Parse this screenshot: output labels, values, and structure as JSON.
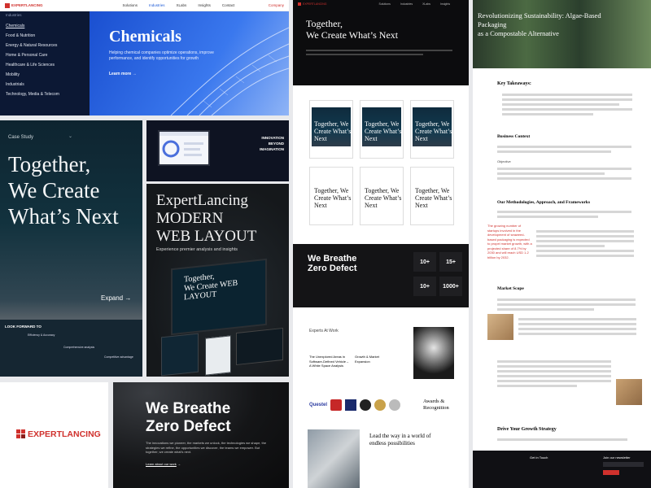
{
  "nav": {
    "brand": "EXPERTLANCING",
    "items": [
      "Solutions",
      "Industries",
      "XLabs",
      "Insights",
      "Contact"
    ],
    "company": "Company"
  },
  "industries": {
    "label": "Industries",
    "list": [
      "Chemicals",
      "Food & Nutrition",
      "Energy & Natural Resources",
      "Home & Personal Care",
      "Healthcare & Life Sciences",
      "Mobility",
      "Industrials",
      "Technology, Media & Telecom"
    ],
    "hero_title": "Chemicals",
    "hero_text": "Helping chemical companies optimize operations, improve performance, and identify opportunities for growth",
    "learn_more": "Learn more"
  },
  "case_study": {
    "label": "Case Study",
    "title_lines": [
      "Together,",
      "We Create",
      "What’s Next"
    ],
    "expand": "Expand",
    "look_forward": "LOOK FORWARD TO",
    "efficiency": "Efficiency & Accuracy",
    "comprehensive": "Comprehensive analysis",
    "competitive": "Competitive advantage"
  },
  "innovation": {
    "lines": [
      "INNOVATION",
      "BEYOND",
      "IMAGINATION"
    ]
  },
  "modern": {
    "title_lines": [
      "ExpertLancing",
      "MODERN",
      "WEB LAYOUT"
    ],
    "subtitle": "Experience premier analysis and insights",
    "screen_lines": [
      "Together,",
      "We Create WEB",
      "LAYOUT"
    ]
  },
  "brand_logo": "EXPERTLANCING",
  "zero_defect": {
    "title_lines": [
      "We Breathe",
      "Zero Defect"
    ],
    "text": "The innovations we pioneer, the markets we unlock, the technologies we shape, the strategies we refine, the opportunities we discover, the teams we empower. But together, we create what's next.",
    "link": "Learn about our work"
  },
  "middle": {
    "hero_lines": [
      "Together,",
      "We Create What’s Next"
    ],
    "tiles": [
      "Together, We Create What’s Next",
      "Together, We Create What’s Next",
      "Together, We Create What’s Next",
      "Together, We Create What’s Next",
      "Together, We Create What’s Next",
      "Together, We Create What’s Next"
    ],
    "zero_title_lines": [
      "We Breathe",
      "Zero Defect"
    ],
    "stats": [
      "10+",
      "15+",
      "10+",
      "1000+"
    ],
    "experts_label": "Experts At Work",
    "card1": "The Unexplored Areas in Software-Defined Vehicle – A White Space Analysis",
    "card2": "Growth & Market Expansion",
    "awards_lines": [
      "Awards &",
      "Recognition"
    ],
    "lead_lines": [
      "Lead the way in a world of",
      "endless possibilities"
    ],
    "logos": [
      "Questel",
      "",
      "",
      "",
      ""
    ]
  },
  "article": {
    "title_lines": [
      "Revolutionizing Sustainability: Algae-Based Packaging",
      "as a Compostable Alternative"
    ],
    "key_takeaways": "Key Takeaways:",
    "business_context": "Business Context",
    "objective": "Objective",
    "methodologies": "Our Methodologies, Approach, and Frameworks",
    "market_scope": "Market Scope",
    "quote": "The growing number of startups involved in the development of seaweed-based packaging is expected to propel market growth, with a projected share of 8.7% by 2030 and will reach USD 1.2 billion by 2032.",
    "drive_growth": "Drive Your Growth Strategy",
    "footer_touch": "Get in Touch",
    "footer_newsletter": "Join our newsletter"
  },
  "colors": {
    "brand_red": "#d0312d",
    "navy": "#0c1834",
    "blue_hero": "#1f5bd6",
    "dark": "#16161a"
  }
}
